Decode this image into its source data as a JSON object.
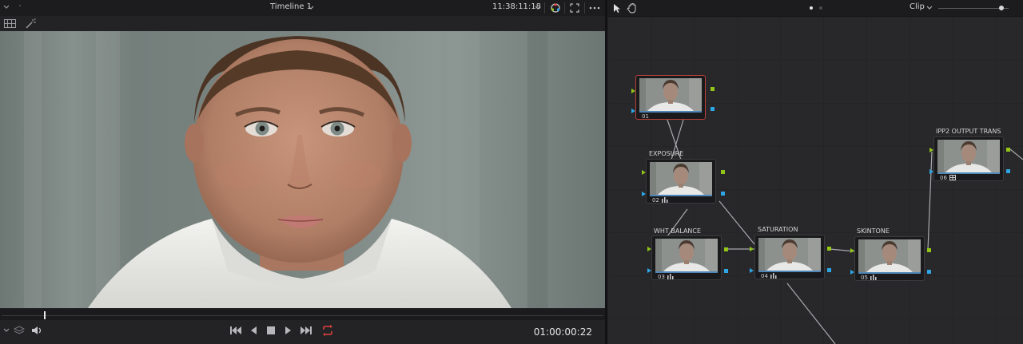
{
  "viewer": {
    "timeline_name": "Timeline 1",
    "source_timecode": "11:38:11:18",
    "record_timecode": "01:00:00:22",
    "playhead_position": 0.07
  },
  "node_editor": {
    "mode_label": "Clip",
    "zoom_level": 0.9,
    "nodes": [
      {
        "number": "01",
        "label": "",
        "selected": true
      },
      {
        "number": "02",
        "label": "EXPOSURE"
      },
      {
        "number": "03",
        "label": "WHT BALANCE"
      },
      {
        "number": "04",
        "label": "SATURATION"
      },
      {
        "number": "05",
        "label": "SKINTONE"
      },
      {
        "number": "06",
        "label": "IPP2 OUTPUT TRANS"
      }
    ]
  },
  "colors": {
    "rgb_port": "#92c518",
    "alpha_port": "#2ea6e6",
    "selected_node": "#b8413b",
    "loop_active": "#e0413a"
  }
}
